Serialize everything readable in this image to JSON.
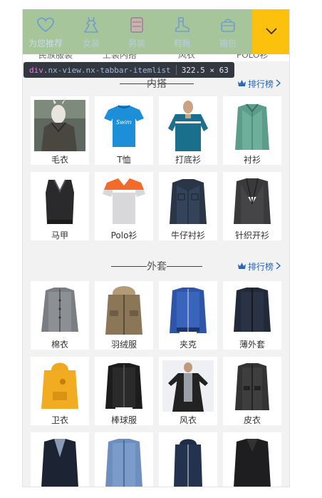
{
  "tabs": [
    {
      "label": "为您推荐",
      "icon": "heart-icon"
    },
    {
      "label": "女装",
      "icon": "dress-icon"
    },
    {
      "label": "男装",
      "icon": "sweater-icon"
    },
    {
      "label": "鞋靴",
      "icon": "boot-icon"
    },
    {
      "label": "箱包",
      "icon": "bag-icon"
    }
  ],
  "more_icon": "chevron-down-icon",
  "peek_labels": [
    "民族服装",
    "上装内搭",
    "风衣",
    "POLO衫"
  ],
  "tooltip": {
    "tag": "div",
    "classes": ".nx-view.nx-tabbar-itemlist",
    "size": "322.5 × 63"
  },
  "rank_label": "排行榜",
  "sections": [
    {
      "title": "内搭",
      "items": [
        {
          "name": "毛衣",
          "icon": "sweater-photo"
        },
        {
          "name": "T恤",
          "icon": "tshirt-photo"
        },
        {
          "name": "打底衫",
          "icon": "tee-photo"
        },
        {
          "name": "衬衫",
          "icon": "shirt-photo"
        },
        {
          "name": "马甲",
          "icon": "vest-photo"
        },
        {
          "name": "Polo衫",
          "icon": "polo-photo"
        },
        {
          "name": "牛仔衬衫",
          "icon": "denim-shirt-photo"
        },
        {
          "name": "针织开衫",
          "icon": "cardigan-photo"
        }
      ]
    },
    {
      "title": "外套",
      "items": [
        {
          "name": "棉衣",
          "icon": "padded-jacket-photo"
        },
        {
          "name": "羽绒服",
          "icon": "down-jacket-photo"
        },
        {
          "name": "夹克",
          "icon": "jacket-photo"
        },
        {
          "name": "薄外套",
          "icon": "light-coat-photo"
        },
        {
          "name": "卫衣",
          "icon": "hoodie-photo"
        },
        {
          "name": "棒球服",
          "icon": "baseball-jacket-photo"
        },
        {
          "name": "风衣",
          "icon": "trench-photo"
        },
        {
          "name": "皮衣",
          "icon": "leather-photo"
        },
        {
          "name": "",
          "icon": "blazer-photo"
        },
        {
          "name": "",
          "icon": "denim-jacket-photo"
        },
        {
          "name": "",
          "icon": "hooded-vest-photo"
        },
        {
          "name": "",
          "icon": "black-coat-photo"
        }
      ]
    }
  ],
  "colors": {
    "tabbar": "#a7c59a",
    "accent": "#fbc10c",
    "link": "#2b67b3"
  }
}
